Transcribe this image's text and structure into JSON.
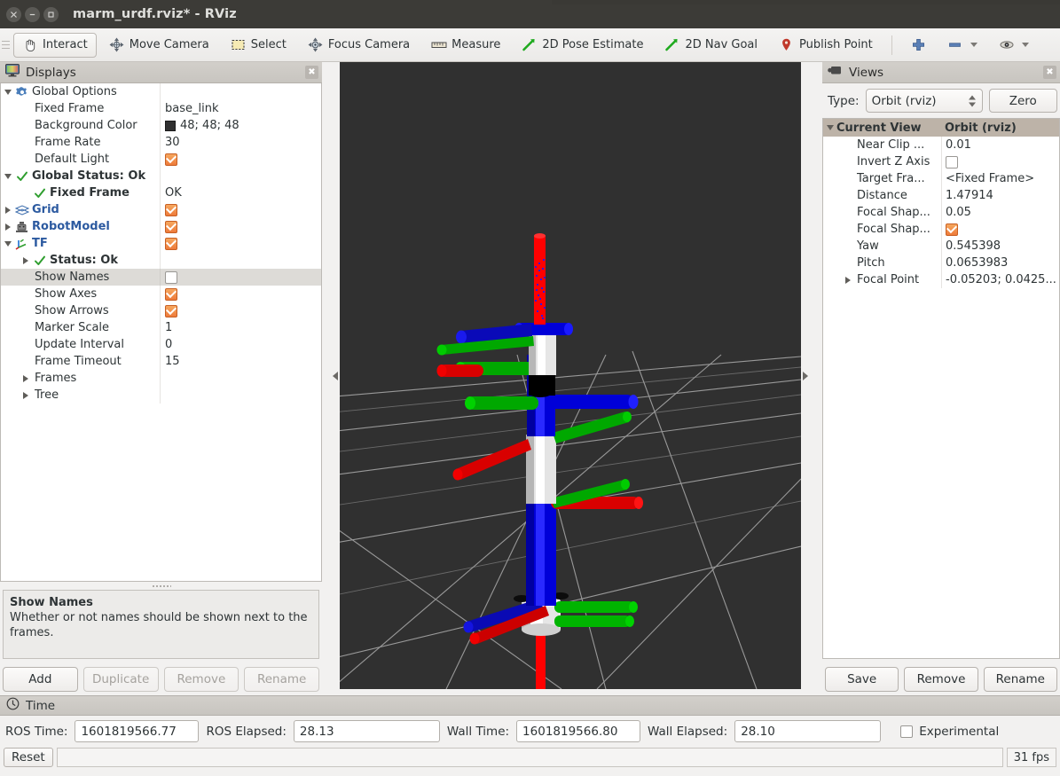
{
  "window": {
    "title": "marm_urdf.rviz* - RViz",
    "close_glyph": "✕",
    "min_glyph": "−",
    "max_glyph": "□"
  },
  "toolbar": {
    "items": [
      {
        "label": "Interact",
        "icon": "hand-cursor-icon",
        "active": true
      },
      {
        "label": "Move Camera",
        "icon": "move-camera-icon",
        "active": false
      },
      {
        "label": "Select",
        "icon": "select-rect-icon",
        "active": false
      },
      {
        "label": "Focus Camera",
        "icon": "focus-camera-icon",
        "active": false
      },
      {
        "label": "Measure",
        "icon": "ruler-icon",
        "active": false
      },
      {
        "label": "2D Pose Estimate",
        "icon": "pose-arrow-icon",
        "active": false
      },
      {
        "label": "2D Nav Goal",
        "icon": "nav-goal-arrow-icon",
        "active": false
      },
      {
        "label": "Publish Point",
        "icon": "map-pin-icon",
        "active": false
      }
    ],
    "add_tool_icon": "plus-icon",
    "remove_tool_icon": "minus-icon",
    "visibility_icon": "eye-icon"
  },
  "displays": {
    "title": "Displays",
    "icon": "monitor-icon",
    "close_glyph": "✖",
    "rows": [
      {
        "indent": 0,
        "twisty": "down",
        "icon": "gear-icon",
        "label": "Global Options",
        "style": "plain",
        "value": "",
        "valtype": "none"
      },
      {
        "indent": 1,
        "twisty": "none",
        "icon": "none",
        "label": "Fixed Frame",
        "style": "plain",
        "value": "base_link",
        "valtype": "text"
      },
      {
        "indent": 1,
        "twisty": "none",
        "icon": "none",
        "label": "Background Color",
        "style": "plain",
        "value": "48; 48; 48",
        "valtype": "color",
        "color": "#303030"
      },
      {
        "indent": 1,
        "twisty": "none",
        "icon": "none",
        "label": "Frame Rate",
        "style": "plain",
        "value": "30",
        "valtype": "text"
      },
      {
        "indent": 1,
        "twisty": "none",
        "icon": "none",
        "label": "Default Light",
        "style": "plain",
        "value": "",
        "valtype": "check-on"
      },
      {
        "indent": 0,
        "twisty": "down",
        "icon": "check-icon",
        "label": "Global Status: Ok",
        "style": "bold",
        "value": "",
        "valtype": "none"
      },
      {
        "indent": 1,
        "twisty": "none",
        "icon": "check-icon",
        "label": "Fixed Frame",
        "style": "bold",
        "value": "OK",
        "valtype": "text"
      },
      {
        "indent": 0,
        "twisty": "right",
        "icon": "grid-icon",
        "label": "Grid",
        "style": "blue",
        "value": "",
        "valtype": "check-on"
      },
      {
        "indent": 0,
        "twisty": "right",
        "icon": "robot-icon",
        "label": "RobotModel",
        "style": "blue",
        "value": "",
        "valtype": "check-on"
      },
      {
        "indent": 0,
        "twisty": "down",
        "icon": "tf-axes-icon",
        "label": "TF",
        "style": "blue",
        "value": "",
        "valtype": "check-on"
      },
      {
        "indent": 1,
        "twisty": "right",
        "icon": "check-icon",
        "label": "Status: Ok",
        "style": "bold",
        "value": "",
        "valtype": "none"
      },
      {
        "indent": 1,
        "twisty": "none",
        "icon": "none",
        "label": "Show Names",
        "style": "plain",
        "value": "",
        "valtype": "check-off",
        "selected": true
      },
      {
        "indent": 1,
        "twisty": "none",
        "icon": "none",
        "label": "Show Axes",
        "style": "plain",
        "value": "",
        "valtype": "check-on"
      },
      {
        "indent": 1,
        "twisty": "none",
        "icon": "none",
        "label": "Show Arrows",
        "style": "plain",
        "value": "",
        "valtype": "check-on"
      },
      {
        "indent": 1,
        "twisty": "none",
        "icon": "none",
        "label": "Marker Scale",
        "style": "plain",
        "value": "1",
        "valtype": "text"
      },
      {
        "indent": 1,
        "twisty": "none",
        "icon": "none",
        "label": "Update Interval",
        "style": "plain",
        "value": "0",
        "valtype": "text"
      },
      {
        "indent": 1,
        "twisty": "none",
        "icon": "none",
        "label": "Frame Timeout",
        "style": "plain",
        "value": "15",
        "valtype": "text"
      },
      {
        "indent": 1,
        "twisty": "right",
        "icon": "none",
        "label": "Frames",
        "style": "plain",
        "value": "",
        "valtype": "none"
      },
      {
        "indent": 1,
        "twisty": "right",
        "icon": "none",
        "label": "Tree",
        "style": "plain",
        "value": "",
        "valtype": "none"
      }
    ],
    "help": {
      "title": "Show Names",
      "body": "Whether or not names should be shown next to the frames."
    },
    "buttons": [
      {
        "label": "Add",
        "disabled": false
      },
      {
        "label": "Duplicate",
        "disabled": true
      },
      {
        "label": "Remove",
        "disabled": true
      },
      {
        "label": "Rename",
        "disabled": true
      }
    ]
  },
  "views": {
    "title": "Views",
    "icon": "camera-icon",
    "close_glyph": "✖",
    "type_label": "Type:",
    "type_value": "Orbit (rviz)",
    "zero_label": "Zero",
    "header": {
      "col1": "Current View",
      "col2": "Orbit (rviz)"
    },
    "rows": [
      {
        "label": "Near Clip ...",
        "value": "0.01",
        "valtype": "text",
        "twisty": "none"
      },
      {
        "label": "Invert Z Axis",
        "value": "",
        "valtype": "check-off",
        "twisty": "none"
      },
      {
        "label": "Target Fra...",
        "value": "<Fixed Frame>",
        "valtype": "text",
        "twisty": "none"
      },
      {
        "label": "Distance",
        "value": "1.47914",
        "valtype": "text",
        "twisty": "none"
      },
      {
        "label": "Focal Shap...",
        "value": "0.05",
        "valtype": "text",
        "twisty": "none"
      },
      {
        "label": "Focal Shap...",
        "value": "",
        "valtype": "check-on",
        "twisty": "none"
      },
      {
        "label": "Yaw",
        "value": "0.545398",
        "valtype": "text",
        "twisty": "none"
      },
      {
        "label": "Pitch",
        "value": "0.0653983",
        "valtype": "text",
        "twisty": "none"
      },
      {
        "label": "Focal Point",
        "value": "-0.05203; 0.0425...",
        "valtype": "text",
        "twisty": "right"
      }
    ],
    "buttons": [
      {
        "label": "Save"
      },
      {
        "label": "Remove"
      },
      {
        "label": "Rename"
      }
    ]
  },
  "time": {
    "title": "Time",
    "icon": "clock-icon",
    "fields": [
      {
        "label": "ROS Time:",
        "value": "1601819566.77",
        "width": "w1"
      },
      {
        "label": "ROS Elapsed:",
        "value": "28.13",
        "width": "w2"
      },
      {
        "label": "Wall Time:",
        "value": "1601819566.80",
        "width": "w1"
      },
      {
        "label": "Wall Elapsed:",
        "value": "28.10",
        "width": "w2"
      }
    ],
    "experimental_label": "Experimental",
    "experimental_checked": false,
    "reset_label": "Reset",
    "fps": "31 fps"
  },
  "viewport": {
    "background_color": "#303030",
    "grid_color": "#b4b4b4",
    "axis_red": "#ff0000",
    "axis_green": "#00c000",
    "axis_blue": "#0000ff",
    "link_white": "#e8e8e8",
    "link_black": "#000000"
  }
}
